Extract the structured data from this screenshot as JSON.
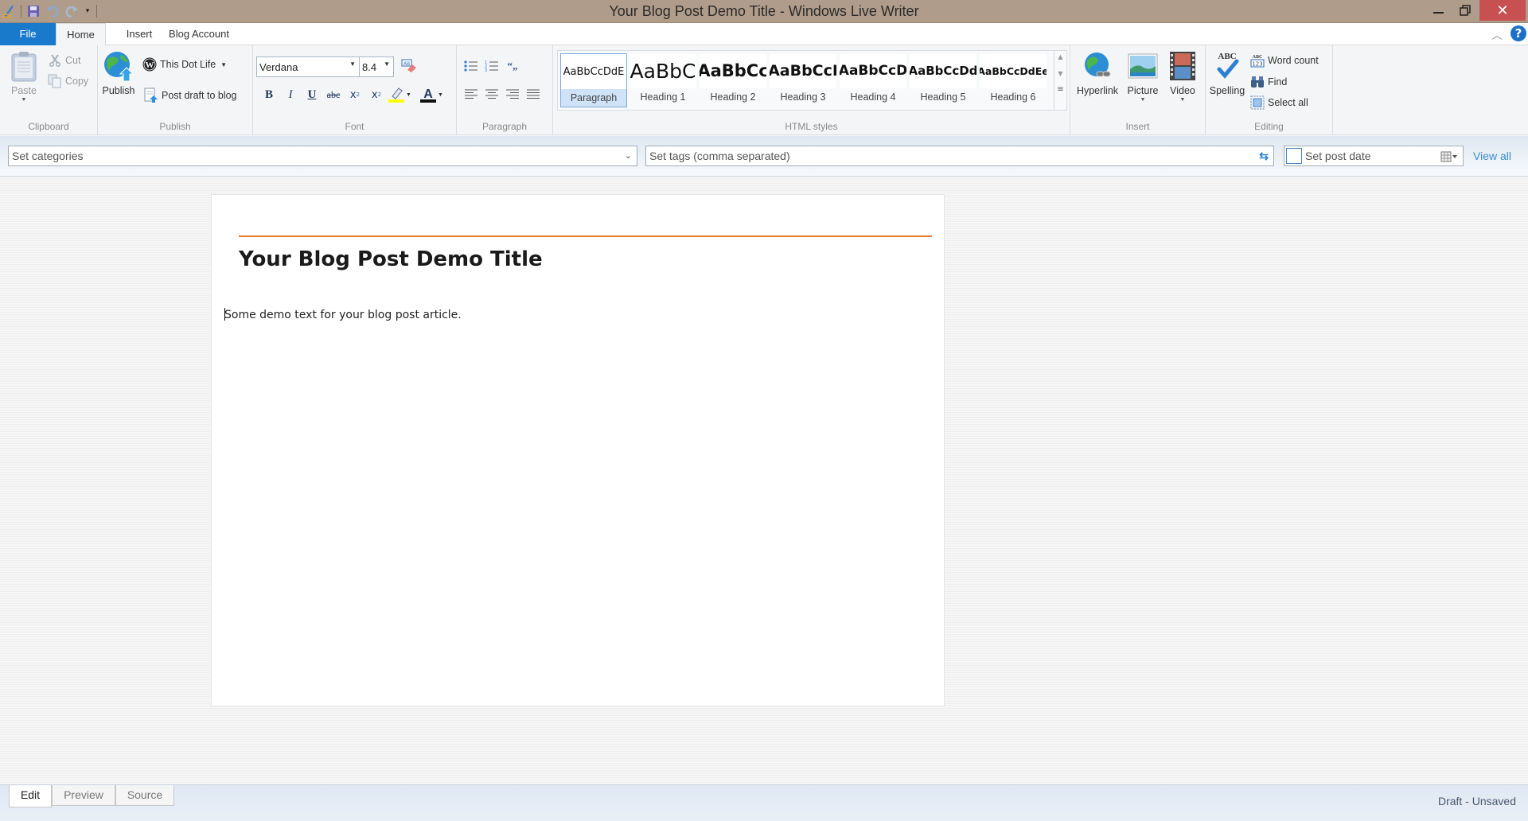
{
  "window": {
    "title": "Your Blog Post Demo Title - Windows Live Writer",
    "controls": {
      "minimize": "—",
      "maximize": "❐",
      "close": "✕"
    }
  },
  "quick_access": {
    "icons": [
      "app-icon",
      "save-icon",
      "undo-icon",
      "redo-icon",
      "customize-qat-icon"
    ]
  },
  "ribbon_tabs": [
    {
      "label": "File"
    },
    {
      "label": "Home",
      "active": true
    },
    {
      "label": "Insert"
    },
    {
      "label": "Blog Account"
    }
  ],
  "ribbon": {
    "clipboard": {
      "label": "Clipboard",
      "paste": "Paste",
      "cut": "Cut",
      "copy": "Copy"
    },
    "publish": {
      "label": "Publish",
      "publish": "Publish",
      "blog_name": "This Dot Life",
      "post_draft": "Post draft to blog"
    },
    "font": {
      "label": "Font",
      "family": "Verdana",
      "size": "8.4",
      "buttons": [
        "B",
        "I",
        "U",
        "abc",
        "x₂",
        "x²"
      ]
    },
    "paragraph": {
      "label": "Paragraph"
    },
    "html_styles": {
      "label": "HTML styles",
      "items": [
        {
          "sample": "AaBbCcDdE",
          "label": "Paragraph",
          "selected": true
        },
        {
          "sample": "AaBbC",
          "label": "Heading 1"
        },
        {
          "sample": "AaBbCc",
          "label": "Heading 2"
        },
        {
          "sample": "AaBbCcI",
          "label": "Heading 3"
        },
        {
          "sample": "AaBbCcD",
          "label": "Heading 4"
        },
        {
          "sample": "AaBbCcDd",
          "label": "Heading 5"
        },
        {
          "sample": "AaBbCcDdEe",
          "label": "Heading 6"
        }
      ]
    },
    "insert": {
      "label": "Insert",
      "hyperlink": "Hyperlink",
      "picture": "Picture",
      "video": "Video"
    },
    "editing": {
      "label": "Editing",
      "spelling": "Spelling",
      "word_count": "Word count",
      "find": "Find",
      "select_all": "Select all"
    }
  },
  "properties": {
    "categories_placeholder": "Set categories",
    "tags_placeholder": "Set tags (comma separated)",
    "post_date_placeholder": "Set post date",
    "view_all": "View all"
  },
  "editor": {
    "title": "Your Blog Post Demo Title",
    "body": "Some demo text for your blog post article.",
    "accent_color": "#f07a2c"
  },
  "view_tabs": [
    {
      "label": "Edit",
      "active": true
    },
    {
      "label": "Preview"
    },
    {
      "label": "Source"
    }
  ],
  "status": "Draft - Unsaved"
}
